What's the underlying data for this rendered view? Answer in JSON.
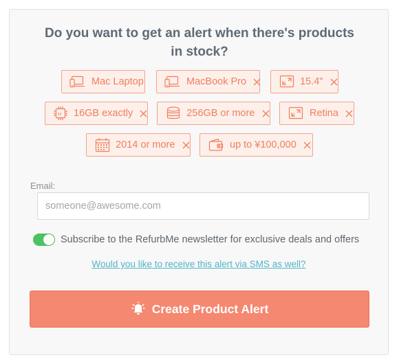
{
  "heading": "Do you want to get an alert when there's products in stock?",
  "colors": {
    "accent": "#f58870",
    "chip_border": "#f3a38c",
    "chip_text": "#f07e5e",
    "toggle_on": "#4bc35f",
    "link": "#4fb4c8"
  },
  "filters": [
    {
      "label": "Mac Laptop",
      "icon": "laptop-phone-icon",
      "removable": false
    },
    {
      "label": "MacBook Pro",
      "icon": "laptop-phone-icon",
      "removable": true
    },
    {
      "label": "15.4\"",
      "icon": "screen-size-icon",
      "removable": true
    },
    {
      "label": "16GB exactly",
      "icon": "memory-chip-icon",
      "removable": true
    },
    {
      "label": "256GB or more",
      "icon": "storage-disk-icon",
      "removable": true
    },
    {
      "label": "Retina",
      "icon": "screen-size-icon",
      "removable": true
    },
    {
      "label": "2014 or more",
      "icon": "calendar-icon",
      "removable": true
    },
    {
      "label": "up to ¥100,000",
      "icon": "wallet-icon",
      "removable": true
    }
  ],
  "email": {
    "label": "Email:",
    "placeholder": "someone@awesome.com",
    "value": ""
  },
  "newsletter": {
    "text": "Subscribe to the RefurbMe newsletter for exclusive deals and offers",
    "enabled": true
  },
  "sms_link": "Would you like to receive this alert via SMS as well?",
  "submit": {
    "label": "Create Product Alert",
    "icon": "alarm-bell-icon"
  }
}
